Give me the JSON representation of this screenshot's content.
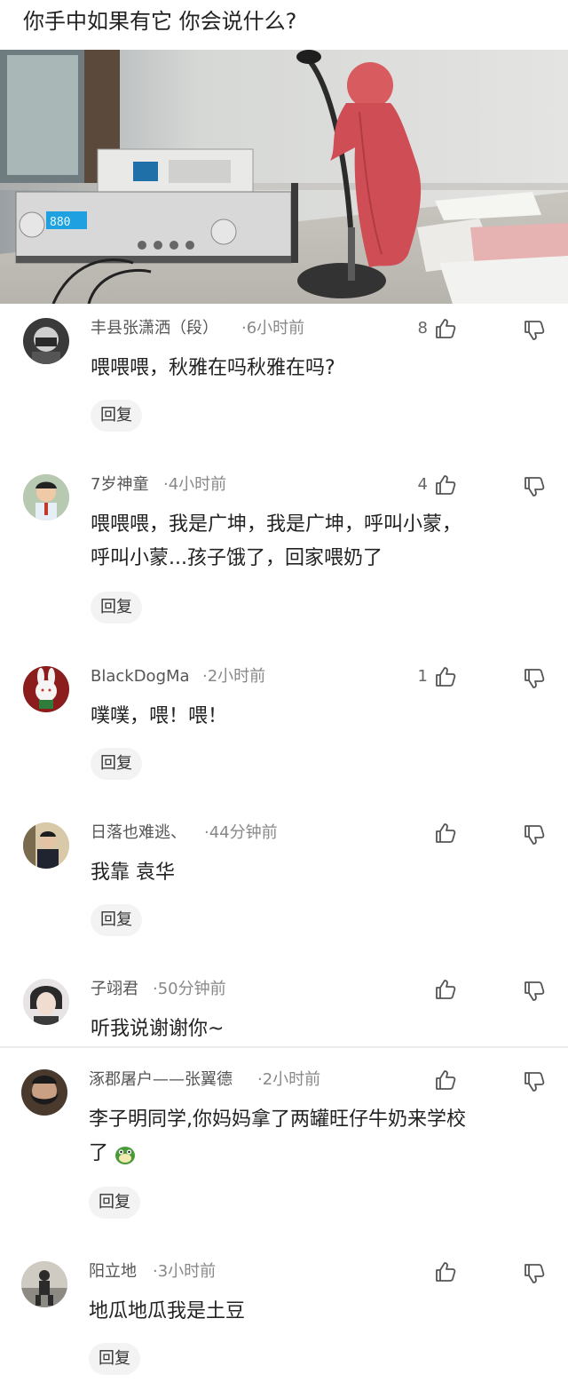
{
  "post": {
    "title": "你手中如果有它   你会说什么?"
  },
  "comments": [
    {
      "user": "丰县张潇洒（段）",
      "time": "·6小时前",
      "likes": "8",
      "text_lines": [
        "喂喂喂，秋雅在吗秋雅在吗?"
      ],
      "reply_label": "回复"
    },
    {
      "user": "7岁神童",
      "time": "·4小时前",
      "likes": "4",
      "text_lines": [
        "喂喂喂，我是广坤，我是广坤，呼叫小蒙，",
        "呼叫小蒙...孩子饿了，回家喂奶了"
      ],
      "reply_label": "回复"
    },
    {
      "user": "BlackDogMa",
      "time": "·2小时前",
      "likes": "1",
      "text_lines": [
        "噗噗，喂！喂！"
      ],
      "reply_label": "回复"
    },
    {
      "user": "日落也难逃、",
      "time": "·44分钟前",
      "likes": "",
      "text_lines": [
        "我靠 袁华"
      ],
      "reply_label": "回复"
    },
    {
      "user": "子翊君",
      "time": "·50分钟前",
      "likes": "",
      "text_lines": [
        "听我说谢谢你~"
      ],
      "reply_label": ""
    },
    {
      "user": "涿郡屠户——张翼德",
      "time": "·2小时前",
      "likes": "",
      "text_lines": [
        "李子明同学,你妈妈拿了两罐旺仔牛奶来学校",
        "了"
      ],
      "reply_label": "回复"
    },
    {
      "user": "阳立地",
      "time": "·3小时前",
      "likes": "",
      "text_lines": [
        "地瓜地瓜我是土豆"
      ],
      "reply_label": "回复"
    }
  ],
  "icons": {
    "like": "thumbs-up-icon",
    "dislike": "thumbs-down-icon",
    "emoji": "green-face-emoji"
  },
  "colors": {
    "text": "#222222",
    "meta": "#888888",
    "reply_bg": "#f3f3f3"
  }
}
